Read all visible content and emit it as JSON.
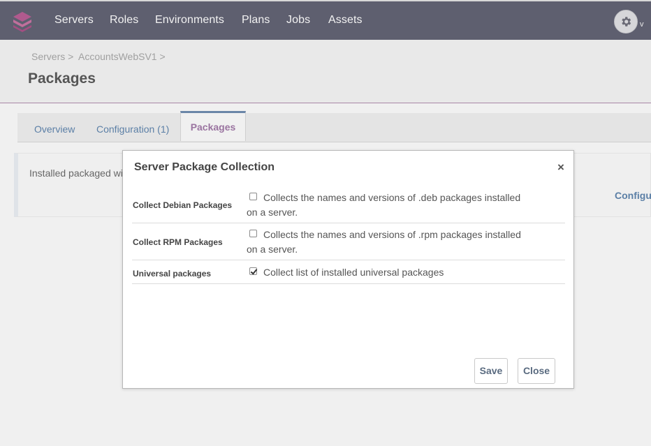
{
  "nav": {
    "items": [
      "Servers",
      "Roles",
      "Environments",
      "Plans",
      "Jobs",
      "Assets"
    ],
    "caret": "v"
  },
  "breadcrumb": {
    "items": [
      "Servers >",
      "AccountsWebSV1 >"
    ]
  },
  "page": {
    "title": "Packages"
  },
  "tabs": [
    {
      "label": "Overview"
    },
    {
      "label": "Configuration (1)"
    },
    {
      "label": "Packages",
      "active": true
    }
  ],
  "panel": {
    "text": "Installed packaged wi",
    "link": "Configu"
  },
  "modal": {
    "title": "Server Package Collection",
    "close_symbol": "×",
    "rows": [
      {
        "label": "Collect Debian Packages",
        "checked": false,
        "description": "Collects the names and versions of .deb packages installed on a server."
      },
      {
        "label": "Collect RPM Packages",
        "checked": false,
        "description": "Collects the names and versions of .rpm packages installed on a server."
      },
      {
        "label": "Universal packages",
        "checked": true,
        "description": "Collect list of installed universal packages"
      }
    ],
    "save_label": "Save",
    "close_label": "Close"
  },
  "colors": {
    "topnav": "#5e5f6f",
    "accent_purple": "#9a74a0",
    "link_blue": "#5b7fa6"
  }
}
